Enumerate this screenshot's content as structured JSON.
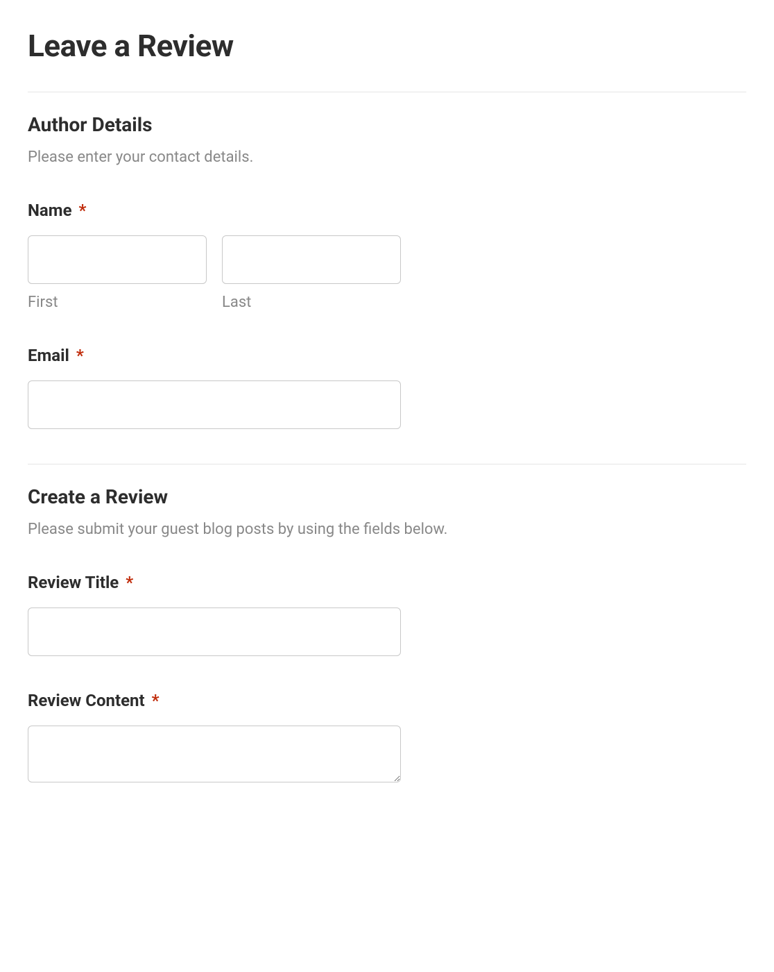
{
  "page": {
    "title": "Leave a Review"
  },
  "sections": {
    "author": {
      "heading": "Author Details",
      "description": "Please enter your contact details.",
      "fields": {
        "name": {
          "label": "Name",
          "required": "*",
          "first_sublabel": "First",
          "last_sublabel": "Last",
          "first_value": "",
          "last_value": ""
        },
        "email": {
          "label": "Email",
          "required": "*",
          "value": ""
        }
      }
    },
    "review": {
      "heading": "Create a Review",
      "description": "Please submit your guest blog posts by using the fields below.",
      "fields": {
        "title": {
          "label": "Review Title",
          "required": "*",
          "value": ""
        },
        "content": {
          "label": "Review Content",
          "required": "*",
          "value": ""
        }
      }
    }
  }
}
